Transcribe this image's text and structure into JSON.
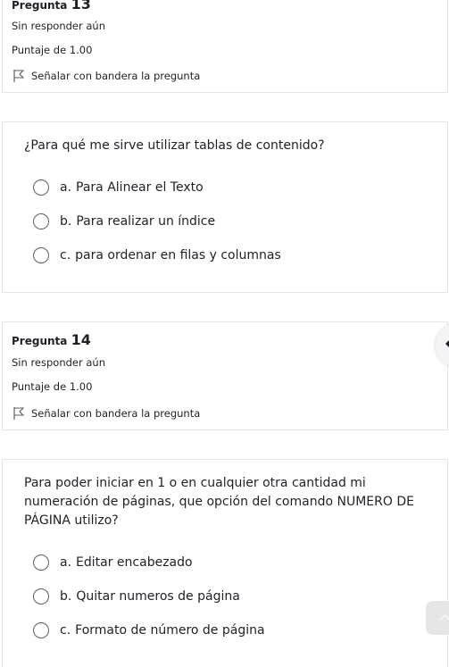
{
  "question13": {
    "label": "Pregunta",
    "number": "13",
    "state": "Sin responder aún",
    "grade": "Puntaje de 1.00",
    "flag_label": "Señalar con bandera la pregunta",
    "text": "¿Para qué me sirve utilizar tablas de contenido?",
    "answers": [
      {
        "letter": "a.",
        "text": "Para Alinear el Texto"
      },
      {
        "letter": "b.",
        "text": "Para realizar un índice"
      },
      {
        "letter": "c.",
        "text": "para ordenar en filas y columnas"
      }
    ]
  },
  "question14": {
    "label": "Pregunta",
    "number": "14",
    "state": "Sin responder aún",
    "grade": "Puntaje de 1.00",
    "flag_label": "Señalar con bandera la pregunta",
    "text": "Para poder iniciar en 1 o en cualquier otra cantidad mi numeración de páginas, que opción del comando NUMERO DE PÁGINA utilizo?",
    "answers": [
      {
        "letter": "a.",
        "text": "Editar encabezado"
      },
      {
        "letter": "b.",
        "text": "Quitar numeros de página"
      },
      {
        "letter": "c.",
        "text": "Formato de número de página"
      }
    ]
  },
  "icons": {
    "flag": "flag-icon",
    "drawer_toggle": "chevron-left-icon",
    "back_to_top": "chevron-up-icon"
  },
  "colors": {
    "border": "#e2e6ea",
    "text": "#1d2125",
    "radio_border": "#5a5f64"
  }
}
